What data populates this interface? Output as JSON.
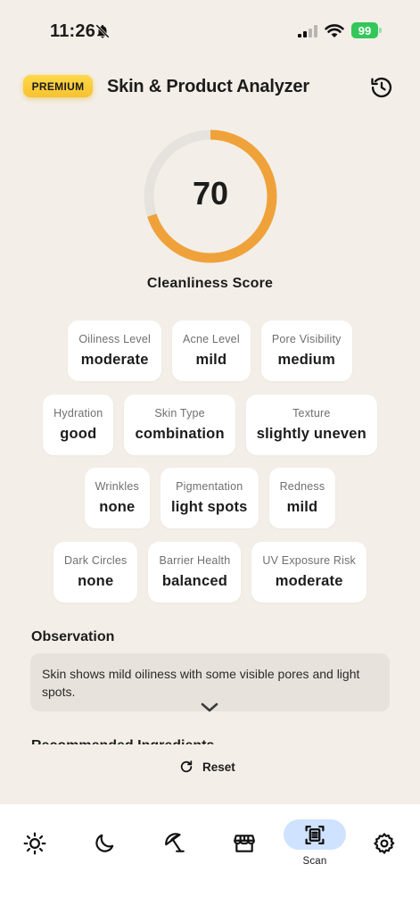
{
  "status_bar": {
    "time": "11:26",
    "battery": "99"
  },
  "header": {
    "badge": "PREMIUM",
    "title": "Skin & Product Analyzer"
  },
  "score": {
    "value": "70",
    "fraction": 0.7,
    "label": "Cleanliness Score",
    "accent_color": "#f0a23a",
    "track_color": "#e6e3de"
  },
  "metrics": [
    [
      {
        "label": "Oiliness Level",
        "value": "moderate"
      },
      {
        "label": "Acne Level",
        "value": "mild"
      },
      {
        "label": "Pore Visibility",
        "value": "medium"
      }
    ],
    [
      {
        "label": "Hydration",
        "value": "good"
      },
      {
        "label": "Skin Type",
        "value": "combination"
      },
      {
        "label": "Texture",
        "value": "slightly uneven"
      }
    ],
    [
      {
        "label": "Wrinkles",
        "value": "none"
      },
      {
        "label": "Pigmentation",
        "value": "light spots"
      },
      {
        "label": "Redness",
        "value": "mild"
      }
    ],
    [
      {
        "label": "Dark Circles",
        "value": "none"
      },
      {
        "label": "Barrier Health",
        "value": "balanced"
      },
      {
        "label": "UV Exposure Risk",
        "value": "moderate"
      }
    ]
  ],
  "observation": {
    "title": "Observation",
    "text": "Skin shows mild oiliness with some visible pores and light spots."
  },
  "next_section": {
    "title": "Recommended Ingredients"
  },
  "reset": {
    "label": "Reset"
  },
  "nav": {
    "items": [
      {
        "icon": "sun-icon"
      },
      {
        "icon": "moon-icon"
      },
      {
        "icon": "beach-umbrella-icon"
      },
      {
        "icon": "store-icon"
      },
      {
        "icon": "scan-icon",
        "label": "Scan",
        "active": true
      },
      {
        "icon": "gear-icon"
      }
    ]
  }
}
